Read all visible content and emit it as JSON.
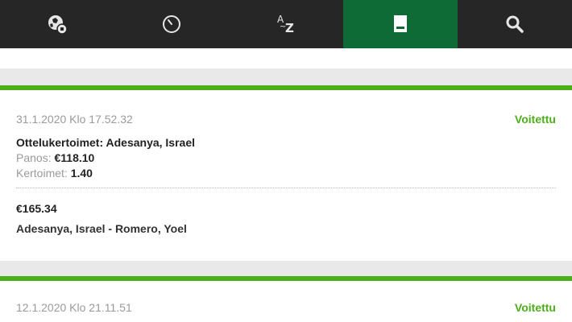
{
  "nav": {
    "items": [
      {
        "icon": "soccer-globe-icon"
      },
      {
        "icon": "clock-icon"
      },
      {
        "icon": "az-sort-icon",
        "top": "A",
        "bottom": "Z",
        "tilde": "~"
      },
      {
        "icon": "betslip-icon",
        "active": true
      },
      {
        "icon": "search-icon"
      }
    ]
  },
  "bets": [
    {
      "date": "31.1.2020 Klo 17.52.32",
      "status": "Voitettu",
      "market": "Ottelukertoimet: Adesanya, Israel",
      "stake_label": "Panos:",
      "stake_value": "€118.10",
      "odds_label": "Kertoimet:",
      "odds_value": "1.40",
      "winnings": "€165.34",
      "event": "Adesanya, Israel - Romero, Yoel"
    },
    {
      "date": "12.1.2020 Klo 21.11.51",
      "status": "Voitettu"
    }
  ],
  "colors": {
    "nav_bg": "#262626",
    "nav_active": "#0f6b35",
    "accent_green": "#4caf1a",
    "page_bg": "#e9e9e9"
  }
}
